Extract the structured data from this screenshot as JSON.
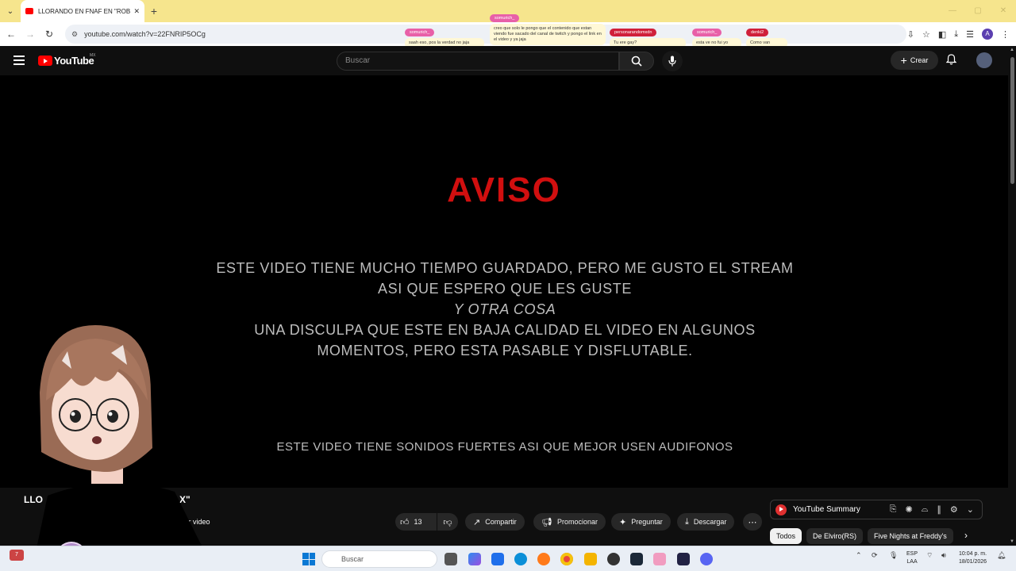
{
  "browser": {
    "tab_title": "LLORANDO EN FNAF EN \"ROB",
    "url": "youtube.com/watch?v=22FNRIP5OCg"
  },
  "chat": [
    {
      "user": "somurich_",
      "msg": "saah eso, pos la verdad no jaja",
      "color": "#e860a8"
    },
    {
      "user": "somurich_",
      "msg": "creo que solo le pongo que el contenido que estan viendo fue sacado del canal de twitch y pongo el link en el video y ya jaja",
      "color": "#e860a8"
    },
    {
      "user": "personarandomxdn",
      "msg": "Tu ere gay?",
      "color": "#d0203a"
    },
    {
      "user": "somurich_",
      "msg": "esta ve no fui yo",
      "color": "#e860a8"
    },
    {
      "user": "denki2",
      "msg": "Como van",
      "color": "#d0203a"
    }
  ],
  "youtube": {
    "logo_text": "YouTube",
    "region": "MX",
    "search_placeholder": "Buscar",
    "create_label": "Crear"
  },
  "video": {
    "heading": "AVISO",
    "notice_line1": "ESTE VIDEO TIENE MUCHO TIEMPO GUARDADO, PERO ME GUSTO EL STREAM",
    "notice_line2": "ASI QUE ESPERO QUE LES GUSTE",
    "notice_line3": "Y OTRA COSA",
    "notice_line4": "UNA DISCULPA QUE ESTE EN BAJA CALIDAD EL VIDEO EN ALGUNOS",
    "notice_line5": "MOMENTOS, PERO ESTA PASABLE Y DISFLUTABLE.",
    "sound_note": "ESTE VIDEO TIENE SONIDOS FUERTES ASI QUE MEJOR USEN AUDIFONOS"
  },
  "below": {
    "title_start": "LLO",
    "title_end": "X\"",
    "edit_label": "litar video",
    "likes": "13",
    "share": "Compartir",
    "promote": "Promocionar",
    "ask": "Preguntar",
    "download": "Descargar"
  },
  "summary": {
    "label": "YouTube Summary"
  },
  "chips": [
    "Todos",
    "De Elviro(RS)",
    "Five Nights at Freddy's"
  ],
  "taskbar": {
    "search_placeholder": "Buscar",
    "lang_1": "ESP",
    "lang_2": "LAA",
    "time": "10:04 p. m.",
    "date": "18/01/2026",
    "notification_count": "7"
  }
}
